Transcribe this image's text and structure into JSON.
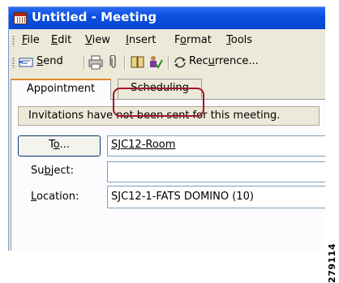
{
  "window": {
    "title": "Untitled - Meeting"
  },
  "menu": [
    {
      "pre": "",
      "u": "F",
      "post": "ile"
    },
    {
      "pre": "",
      "u": "E",
      "post": "dit"
    },
    {
      "pre": "",
      "u": "V",
      "post": "iew"
    },
    {
      "pre": "",
      "u": "I",
      "post": "nsert"
    },
    {
      "pre": "F",
      "u": "o",
      "post": "rmat"
    },
    {
      "pre": "",
      "u": "T",
      "post": "ools"
    }
  ],
  "toolbar": {
    "send_u": "S",
    "send_rest": "end",
    "recurrence_pre": "Rec",
    "recurrence_u": "u",
    "recurrence_post": "rrence..."
  },
  "tabs": {
    "appointment": "Appointment",
    "scheduling": "Scheduling"
  },
  "info_message": "Invitations have not been sent for this meeting.",
  "form": {
    "to_button_u": "o",
    "to_button_pre": "T",
    "to_button_post": "...",
    "to_value": "SJC12-Room",
    "subject_label_pre": "Su",
    "subject_label_u": "b",
    "subject_label_post": "ject:",
    "subject_value": "",
    "location_label_u": "L",
    "location_label_post": "ocation:",
    "location_value": "SJC12-1-FATS DOMINO (10)"
  },
  "figure_id": "279114",
  "colors": {
    "titlebar": "#0a50e0",
    "highlight": "#a0152d",
    "tab_accent": "#e68b2c"
  }
}
